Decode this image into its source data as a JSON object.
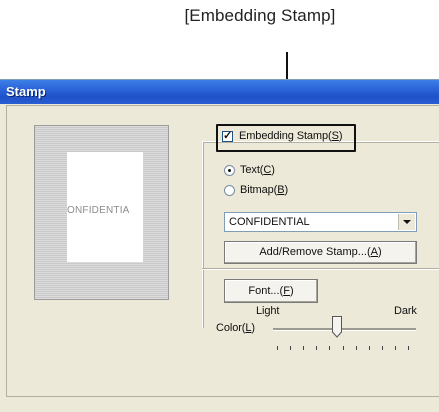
{
  "annotation": {
    "title": "[Embedding Stamp]"
  },
  "window": {
    "title": "Stamp"
  },
  "preview": {
    "stamp_text": "ONFIDENTIA"
  },
  "embedding_stamp": {
    "label": "Embedding Stamp",
    "hotkey": "S",
    "checked": true
  },
  "stamp_type": {
    "options": [
      {
        "label": "Text",
        "hotkey": "C",
        "selected": true
      },
      {
        "label": "Bitmap",
        "hotkey": "B",
        "selected": false
      }
    ]
  },
  "stamp_select": {
    "value": "CONFIDENTIAL"
  },
  "buttons": {
    "add_remove": "Add/Remove Stamp...",
    "add_remove_hotkey": "A",
    "font": "Font...",
    "font_hotkey": "F"
  },
  "color": {
    "label": "Color",
    "hotkey": "L",
    "light_label": "Light",
    "dark_label": "Dark",
    "level": 0.45,
    "tick_count": 11
  }
}
